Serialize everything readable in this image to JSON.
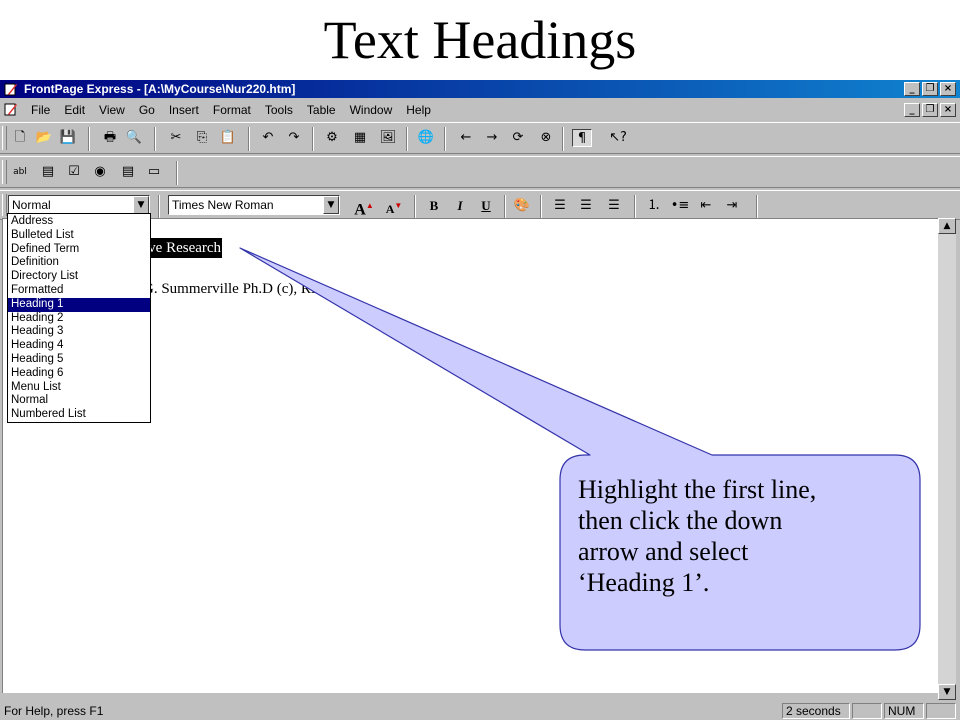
{
  "slide": {
    "title": "Text Headings"
  },
  "window": {
    "title": "FrontPage Express - [A:\\MyCourse\\Nur220.htm]"
  },
  "menubar": {
    "items": [
      "File",
      "Edit",
      "View",
      "Go",
      "Insert",
      "Format",
      "Tools",
      "Table",
      "Window",
      "Help"
    ]
  },
  "toolbars": {
    "standard_icons": [
      "new-icon",
      "open-icon",
      "save-icon",
      "print-icon",
      "print-preview-icon",
      "cut-icon",
      "copy-icon",
      "paste-icon",
      "undo-icon",
      "redo-icon",
      "insert-webbot-icon",
      "insert-table-icon",
      "insert-image-icon",
      "hyperlink-icon",
      "back-icon",
      "forward-icon",
      "refresh-icon",
      "stop-icon",
      "show-formatting-marks-icon",
      "help-icon"
    ],
    "forms_icons": [
      "one-line-textbox-icon",
      "scrolling-textbox-icon",
      "checkbox-icon",
      "radio-button-icon",
      "dropdown-menu-icon",
      "push-button-icon"
    ],
    "style_value": "Normal",
    "font_value": "Times New Roman"
  },
  "style_dropdown": {
    "options": [
      "Address",
      "Bulleted List",
      "Defined Term",
      "Definition",
      "Directory List",
      "Formatted",
      "Heading 1",
      "Heading 2",
      "Heading 3",
      "Heading 4",
      "Heading 5",
      "Heading 6",
      "Menu List",
      "Normal",
      "Numbered List"
    ],
    "selected": "Heading 1"
  },
  "document": {
    "line1_visible": "ive Research",
    "line2_visible": "G. Summerville Ph.D (c), RN."
  },
  "callout": {
    "line1": "Highlight the first line,",
    "line2": "then click the down",
    "line3": "arrow and select",
    "line4": "‘Heading 1’.",
    "fill_color": "#ccccff"
  },
  "statusbar": {
    "help": "For Help, press F1",
    "time": "2 seconds",
    "num": "NUM"
  },
  "colors": {
    "titlebar": "#000080",
    "selection": "#000080",
    "chrome": "#c0c0c0"
  }
}
